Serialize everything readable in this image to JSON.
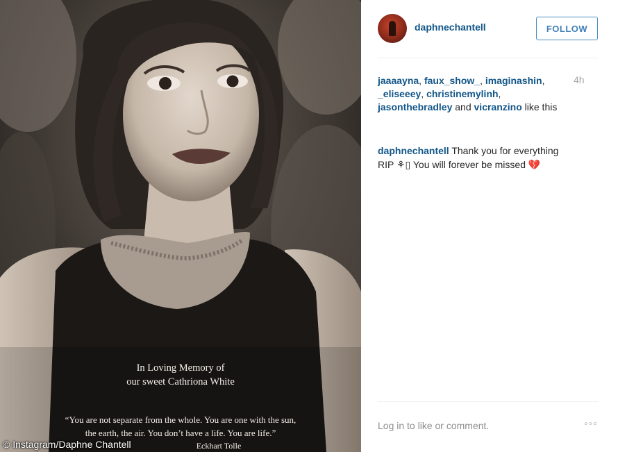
{
  "photo": {
    "memorial_lines": [
      "In Loving Memory of",
      "our sweet Cathriona White"
    ],
    "quote_lines": [
      "“You are not separate from the whole. You are one with the sun,",
      "the earth, the air. You don’t have a life. You are life.”"
    ],
    "quote_attribution": "Eckhart Tolle",
    "credit": "© Instagram/Daphne Chantell"
  },
  "header": {
    "username": "daphnechantell",
    "follow_label": "FOLLOW"
  },
  "likes": {
    "users": [
      "jaaaayna",
      "faux_show_",
      "imaginashin",
      "_eliseeey",
      "christinemylinh",
      "jasonthebradley",
      "vicranzino"
    ],
    "conjunction": "and",
    "suffix": "like this",
    "time": "4h"
  },
  "comment": {
    "author": "daphnechantell",
    "text_line1": "Thank you for everything",
    "text_line2": "RIP ⚘▯ You will forever be missed 💔"
  },
  "footer": {
    "login_text": "Log in to like or comment.",
    "more_label": "◦◦◦"
  },
  "colors": {
    "link": "#125688",
    "follow_border": "#4a8fc3",
    "muted": "#a5a7aa"
  }
}
